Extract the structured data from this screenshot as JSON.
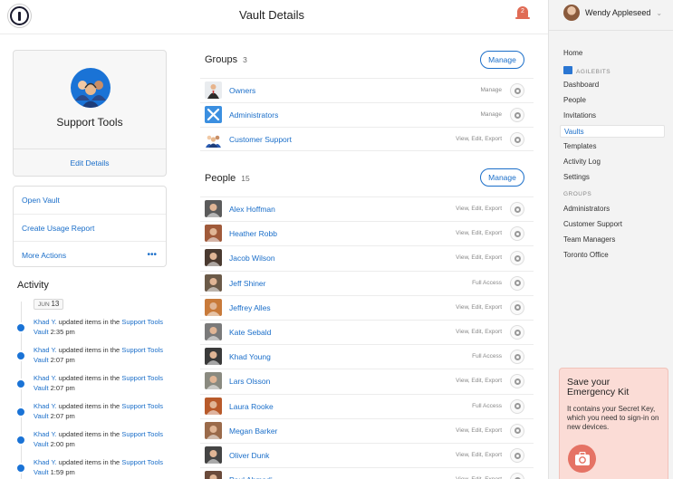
{
  "header": {
    "title": "Vault Details",
    "notifications": "2"
  },
  "user": {
    "name": "Wendy Appleseed"
  },
  "sidebar": {
    "items": [
      {
        "label": "Home",
        "active": false
      },
      {
        "label": "AGILEBITS",
        "section": true
      },
      {
        "label": "Dashboard",
        "active": false
      },
      {
        "label": "People",
        "active": false
      },
      {
        "label": "Invitations",
        "active": false
      },
      {
        "label": "Vaults",
        "active": true
      },
      {
        "label": "Templates",
        "active": false
      },
      {
        "label": "Activity Log",
        "active": false
      },
      {
        "label": "Settings",
        "active": false
      },
      {
        "label": "GROUPS",
        "section": true
      },
      {
        "label": "Administrators",
        "active": false
      },
      {
        "label": "Customer Support",
        "active": false
      },
      {
        "label": "Team Managers",
        "active": false
      },
      {
        "label": "Toronto Office",
        "active": false
      }
    ]
  },
  "emergency_kit": {
    "title": "Save your Emergency Kit",
    "text": "It contains your Secret Key, which you need to sign-in on new devices."
  },
  "vault": {
    "name": "Support Tools",
    "edit_label": "Edit Details"
  },
  "actions": [
    {
      "label": "Open Vault"
    },
    {
      "label": "Create Usage Report"
    },
    {
      "label": "More Actions",
      "extra": "•••"
    }
  ],
  "activity": {
    "title": "Activity",
    "date_month": "JUN",
    "date_day": "13",
    "entries": [
      {
        "who": "Khad Y.",
        "text": " updated items in the ",
        "vault": "Support Tools Vault",
        "time": "2:35 pm"
      },
      {
        "who": "Khad Y.",
        "text": " updated items in the ",
        "vault": "Support Tools Vault",
        "time": "2:07 pm"
      },
      {
        "who": "Khad Y.",
        "text": " updated items in the ",
        "vault": "Support Tools Vault",
        "time": "2:07 pm"
      },
      {
        "who": "Khad Y.",
        "text": " updated items in the ",
        "vault": "Support Tools Vault",
        "time": "2:07 pm"
      },
      {
        "who": "Khad Y.",
        "text": " updated items in the ",
        "vault": "Support Tools Vault",
        "time": "2:00 pm"
      },
      {
        "who": "Khad Y.",
        "text": " updated items in the ",
        "vault": "Support Tools Vault",
        "time": "1:59 pm"
      }
    ]
  },
  "groups": {
    "title": "Groups",
    "count": "3",
    "manage_label": "Manage",
    "rows": [
      {
        "name": "Owners",
        "perm": "Manage",
        "icon": "owners-icon"
      },
      {
        "name": "Administrators",
        "perm": "Manage",
        "icon": "tools-icon"
      },
      {
        "name": "Customer Support",
        "perm": "View, Edit, Export",
        "icon": "team-icon"
      }
    ]
  },
  "people": {
    "title": "People",
    "count": "15",
    "manage_label": "Manage",
    "rows": [
      {
        "name": "Alex Hoffman",
        "perm": "View, Edit, Export",
        "color": "#5b5b5b"
      },
      {
        "name": "Heather Robb",
        "perm": "View, Edit, Export",
        "color": "#a05a3a"
      },
      {
        "name": "Jacob Wilson",
        "perm": "View, Edit, Export",
        "color": "#4a3a30"
      },
      {
        "name": "Jeff Shiner",
        "perm": "Full Access",
        "color": "#6b5a48"
      },
      {
        "name": "Jeffrey Alles",
        "perm": "View, Edit, Export",
        "color": "#c87a3a"
      },
      {
        "name": "Kate Sebald",
        "perm": "View, Edit, Export",
        "color": "#7a7a7a"
      },
      {
        "name": "Khad Young",
        "perm": "Full Access",
        "color": "#3a3a3a"
      },
      {
        "name": "Lars Olsson",
        "perm": "View, Edit, Export",
        "color": "#8a8a80"
      },
      {
        "name": "Laura Rooke",
        "perm": "Full Access",
        "color": "#b85a2a"
      },
      {
        "name": "Megan Barker",
        "perm": "View, Edit, Export",
        "color": "#9a6a4a"
      },
      {
        "name": "Oliver Dunk",
        "perm": "View, Edit, Export",
        "color": "#444444"
      },
      {
        "name": "Paul Ahmadi",
        "perm": "View, Edit, Export",
        "color": "#6a4a3a"
      }
    ]
  }
}
